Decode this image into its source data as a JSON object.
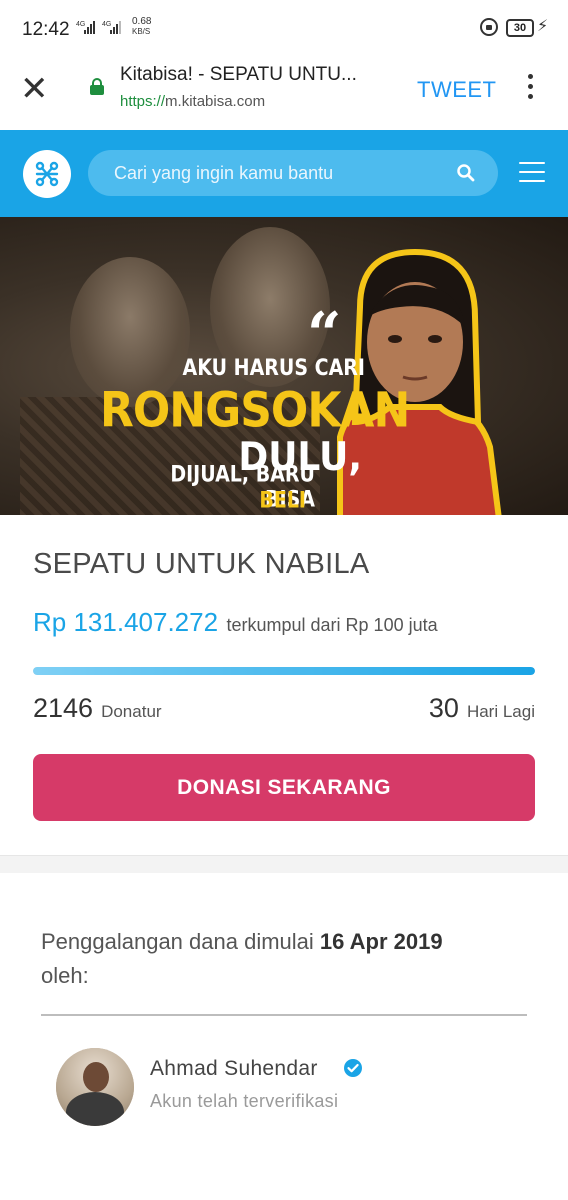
{
  "status_bar": {
    "time": "12:42",
    "signal_text": "4G▮▮▮ ⁴⁶4G▮▮▮",
    "speed_value": "0.68",
    "speed_unit": "KB/S",
    "battery": "30"
  },
  "browser": {
    "tab_title": "Kitabisa! - SEPATU UNTU...",
    "url_protocol": "https://",
    "url_host": "m.kitabisa.com",
    "tweet_label": "TWEET"
  },
  "site_header": {
    "search_placeholder": "Cari yang ingin kamu bantu",
    "brand_color": "#1aa4e6"
  },
  "hero": {
    "quote_mark": "“",
    "line1": "AKU HARUS CARI",
    "line2": "RONGSOKAN",
    "line3": "DULU,",
    "line4": "DIJUAL, BARU BISA",
    "line5": "BELI SEPATU,"
  },
  "campaign": {
    "title": "SEPATU UNTUK NABILA",
    "raised_amount": "Rp 131.407.272",
    "raised_text": "terkumpul dari Rp 100 juta",
    "progress_fraction": 1.0,
    "donors_count": "2146",
    "donors_label": "Donatur",
    "days_count": "30",
    "days_label": "Hari Lagi",
    "donate_label": "DONASI SEKARANG",
    "donate_color": "#d63a68"
  },
  "organizer": {
    "started_prefix": "Penggalangan dana dimulai",
    "started_date": "16 Apr 2019",
    "started_suffix": "oleh:",
    "name": "Ahmad Suhendar",
    "status": "Akun telah terverifikasi"
  }
}
